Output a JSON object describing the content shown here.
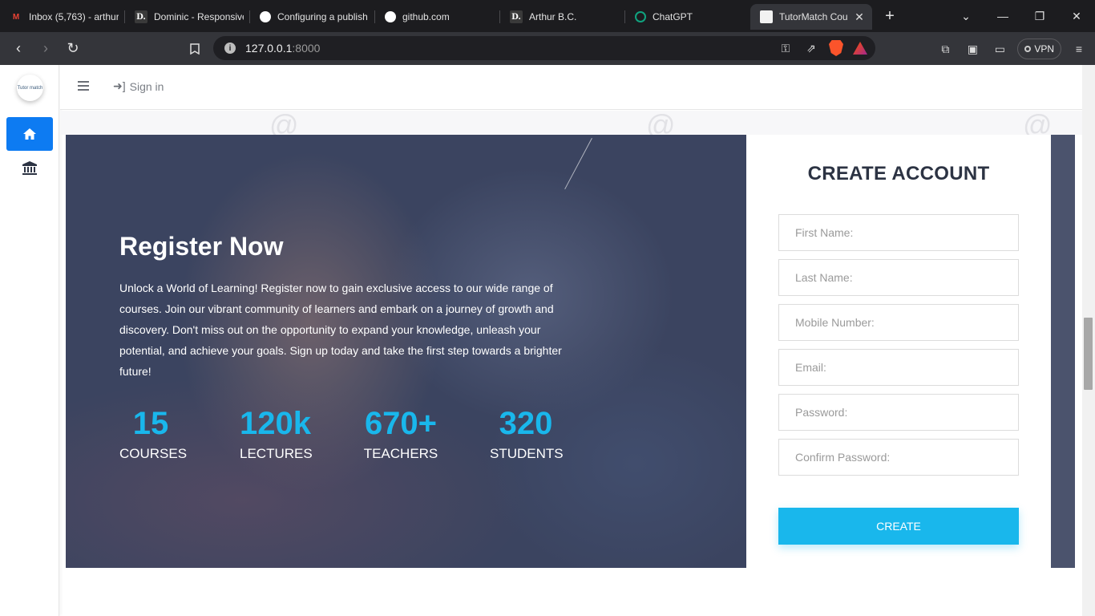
{
  "browser": {
    "tabs": [
      {
        "title": "Inbox (5,763) - arthur",
        "icon": "gmail-icon"
      },
      {
        "title": "Dominic - Responsive",
        "icon": "d-icon"
      },
      {
        "title": "Configuring a publish",
        "icon": "github-icon"
      },
      {
        "title": "github.com",
        "icon": "github-icon"
      },
      {
        "title": "Arthur B.C.",
        "icon": "d-icon"
      },
      {
        "title": "ChatGPT",
        "icon": "chatgpt-icon"
      },
      {
        "title": "TutorMatch Cou",
        "icon": "tutormatch-icon",
        "active": true
      }
    ],
    "new_tab": "+",
    "url_host": "127.0.0.1",
    "url_port": ":8000",
    "vpn_label": "VPN"
  },
  "sidebar": {
    "logo_text": "Tutor match",
    "items": [
      {
        "name": "home",
        "icon": "home-icon",
        "active": true
      },
      {
        "name": "institution",
        "icon": "bank-icon",
        "active": false
      }
    ]
  },
  "topnav": {
    "signin_label": "Sign in"
  },
  "hero": {
    "title": "Register Now",
    "text": "Unlock a World of Learning! Register now to gain exclusive access to our wide range of courses. Join our vibrant community of learners and embark on a journey of growth and discovery. Don't miss out on the opportunity to expand your knowledge, unleash your potential, and achieve your goals. Sign up today and take the first step towards a brighter future!",
    "stats": [
      {
        "value": "15",
        "label": "COURSES"
      },
      {
        "value": "120k",
        "label": "LECTURES"
      },
      {
        "value": "670+",
        "label": "TEACHERS"
      },
      {
        "value": "320",
        "label": "STUDENTS"
      }
    ]
  },
  "form": {
    "title": "CREATE ACCOUNT",
    "fields": [
      {
        "placeholder": "First Name:",
        "value": ""
      },
      {
        "placeholder": "Last Name:",
        "value": ""
      },
      {
        "placeholder": "Mobile Number:",
        "value": ""
      },
      {
        "placeholder": "Email:",
        "value": ""
      },
      {
        "placeholder": "Password:",
        "value": ""
      },
      {
        "placeholder": "Confirm Password:",
        "value": ""
      }
    ],
    "submit_label": "CREATE"
  },
  "colors": {
    "accent": "#19b7ec",
    "sidebar_active": "#0d7bf2",
    "hero_bg": "#3b4460"
  }
}
